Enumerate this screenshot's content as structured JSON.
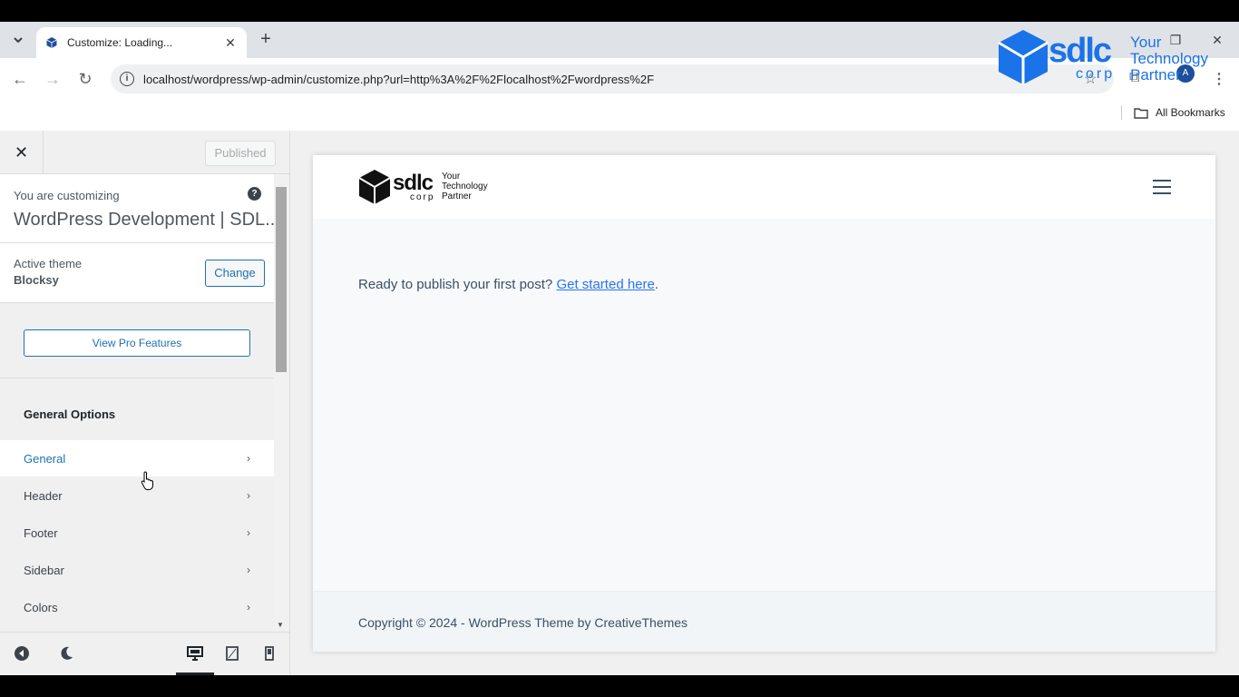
{
  "browser": {
    "tab_title": "Customize: Loading...",
    "tab_close": "✕",
    "new_tab": "+",
    "url": "localhost/wordpress/wp-admin/customize.php?url=http%3A%2F%2Flocalhost%2Fwordpress%2F",
    "all_bookmarks": "All Bookmarks",
    "avatar_letter": "A"
  },
  "watermark": {
    "brand": "sdlc",
    "corp": "corp",
    "line1": "Your",
    "line2": "Technology",
    "line3": "Partner"
  },
  "customizer": {
    "published_label": "Published",
    "customizing_label": "You are customizing",
    "site_title": "WordPress Development | SDL...",
    "active_theme_label": "Active theme",
    "theme_name": "Blocksy",
    "change_label": "Change",
    "pro_label": "View Pro Features",
    "section_title": "General Options",
    "menu": [
      {
        "label": "General"
      },
      {
        "label": "Header"
      },
      {
        "label": "Footer"
      },
      {
        "label": "Sidebar"
      },
      {
        "label": "Colors"
      }
    ]
  },
  "preview": {
    "logo_brand": "sdlc",
    "logo_corp": "corp",
    "logo_line1": "Your",
    "logo_line2": "Technology",
    "logo_line3": "Partner",
    "message": "Ready to publish your first post?",
    "link_text": "Get started here",
    "period": ".",
    "copyright": "Copyright © 2024 - WordPress Theme by CreativeThemes"
  },
  "colors": {
    "accent": "#2271b1",
    "link": "#2872fa",
    "brand_blue": "#1a73e8"
  }
}
